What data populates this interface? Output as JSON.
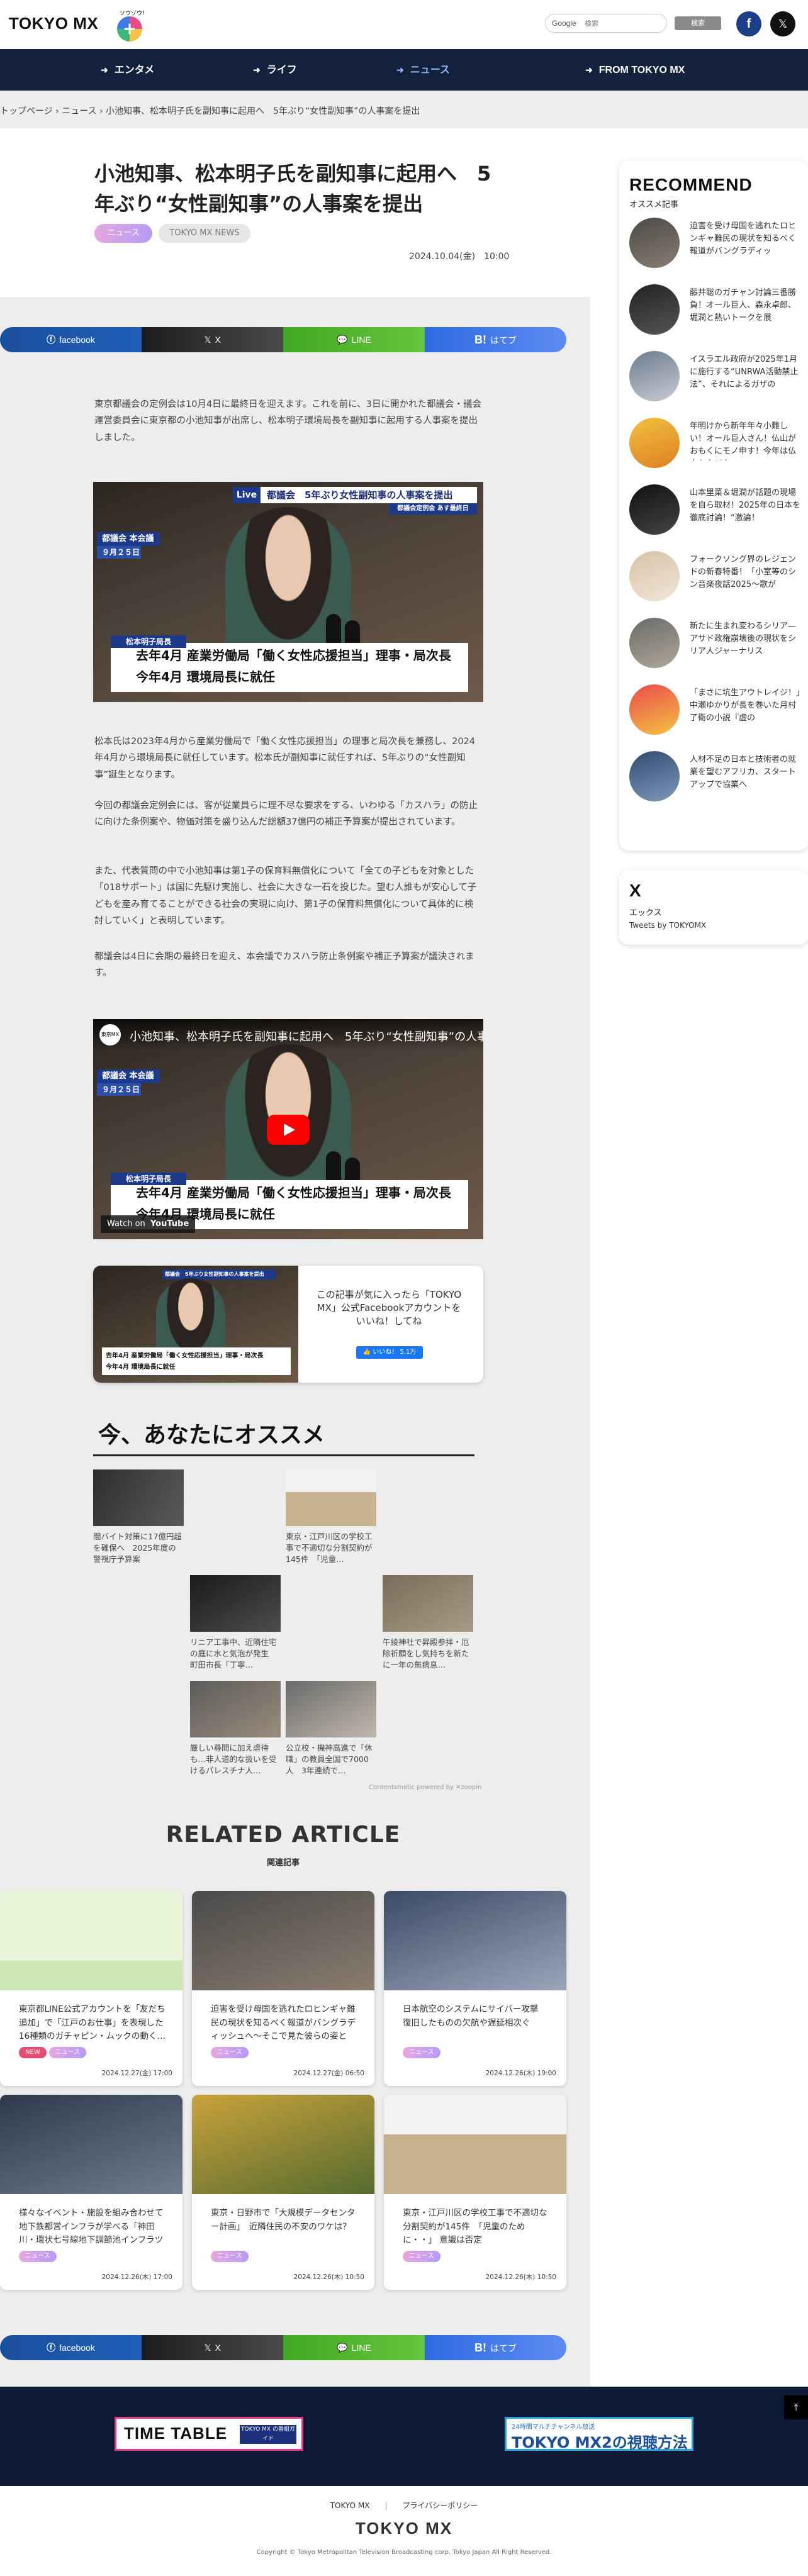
{
  "header": {
    "logo_text": "TOKYO MX",
    "logo_sub": "ソウゾウ！",
    "search_label": "Google",
    "search_placeholder": "検索",
    "search_button": "検索",
    "facebook_icon": "f",
    "x_icon": "𝕏"
  },
  "nav": {
    "items": [
      {
        "label": "エンタメ"
      },
      {
        "label": "ライフ"
      },
      {
        "label": "ニュース"
      },
      {
        "label": "FROM TOKYO MX"
      }
    ],
    "active_index": 2
  },
  "breadcrumb": "トップページ  ›  ニュース  ›  小池知事、松本明子氏を副知事に起用へ　5年ぶり“女性副知事”の人事案を提出",
  "article": {
    "title": "小池知事、松本明子氏を副知事に起用へ　5年ぶり“女性副知事”の人事案を提出",
    "tags": [
      "ニュース",
      "TOKYO MX NEWS"
    ],
    "date": "2024.10.04(金)　10:00",
    "share": {
      "facebook": "facebook",
      "x": "X",
      "line": "LINE",
      "hatena": "はてブ",
      "hatena_mark": "B!"
    },
    "paragraphs": [
      "東京都議会の定例会は10月4日に最終日を迎えます。これを前に、3日に開かれた都議会・議会運営委員会に東京都の小池知事が出席し、松本明子環境局長を副知事に起用する人事案を提出しました。",
      "松本氏は2023年4月から産業労働局で「働く女性応援担当」の理事と局次長を兼務し、2024年4月から環境局長に就任しています。松本氏が副知事に就任すれば、5年ぶりの“女性副知事”誕生となります。",
      "今回の都議会定例会には、客が従業員らに理不尽な要求をする、いわゆる「カスハラ」の防止に向けた条例案や、物価対策を盛り込んだ総額37億円の補正予算案が提出されています。",
      "また、代表質問の中で小池知事は第1子の保育料無償化について「全ての子どもを対象とした「018サポート」は国に先駆け実施し、社会に大きな一石を投じた。望む人誰もが安心して子どもを産み育てることができる社会の実現に向け、第1子の保育料無償化について具体的に検討していく」と表明しています。",
      "都議会は4日に会期の最終日を迎え、本会議でカスハラ防止条例案や補正予算案が議決されます。"
    ],
    "photo": {
      "live": "Live",
      "banner": "都議会　5年ぶり女性副知事の人事案を提出",
      "banner_sub": "都議会定例会 あす最終日",
      "location": "都議会 本会議",
      "location_date": "９月２５日",
      "name": "松本明子局長",
      "line1": "去年4月 産業労働局「働く女性応援担当」理事・局次長",
      "line2": "今年4月 環境局長に就任"
    },
    "video": {
      "channel": "東京MX",
      "title": "小池知事、松本明子氏を副知事に起用へ　5年ぶり“女性副知事”の人事案を提出",
      "watch_on": "Watch on",
      "youtube": "YouTube"
    },
    "fb_promo": {
      "text": "この記事が気に入ったら「TOKYO MX」公式Facebookアカウントをいいね！してね",
      "like": "👍 いいね！ 5.1万"
    }
  },
  "recommend": {
    "heading": "今、あなたにオススメ",
    "items": [
      {
        "caption": "闇バイト対策に17億円超を確保へ　2025年度の警視庁予算案"
      },
      {
        "caption": "東京・江戸川区の学校工事で不適切な分割契約が145件　「児童…"
      },
      {
        "caption": "リニア工事中、近隣住宅の庭に水と気泡が発生　町田市長「丁寧…"
      },
      {
        "caption": "午綾神社で昇殿参拝・厄除祈願をし気持ちを新たに一年の無病息…"
      },
      {
        "caption": "厳しい尋問に加え虐待も…非人道的な扱いを受けるパレスチナ人…"
      },
      {
        "caption": "公立校・機神高進で「休職」の教員全国で7000人　3年連続で…"
      }
    ],
    "powered": "Contentsmatic powered by ✕zoopin"
  },
  "related": {
    "heading": "RELATED ARTICLE",
    "sub": "関連記事",
    "cards": [
      {
        "title": "東京都LINE公式アカウントを「友だち追加」で「江戸のお仕事」を表現した16種類のガチャピン・ムックの動く…",
        "tags": [
          "NEW",
          "ニュース"
        ],
        "date": "2024.12.27(金) 17:00"
      },
      {
        "title": "迫害を受け母国を逃れたロヒンギャ難民の現状を知るべく報道がバングラディッシュへ～そこで見た彼らの姿と",
        "tags": [
          "ニュース"
        ],
        "date": "2024.12.27(金) 06:50"
      },
      {
        "title": "日本航空のシステムにサイバー攻撃　復旧したものの欠航や遅延相次ぐ",
        "tags": [
          "ニュース"
        ],
        "date": "2024.12.26(木) 19:00"
      },
      {
        "title": "様々なイベント・施設を組み合わせて地下鉄都営インフラが学べる「神田川・環状七号線地下調節池インフラツ",
        "tags": [
          "ニュース"
        ],
        "date": "2024.12.26(木) 17:00"
      },
      {
        "title": "東京・日野市で「大規模データセンター計画」　近隣住民の不安のワケは？",
        "tags": [
          "ニュース"
        ],
        "date": "2024.12.26(木) 10:50"
      },
      {
        "title": "東京・江戸川区の学校工事で不適切な分割契約が145件　「児童のために・・」 意識は否定",
        "tags": [
          "ニュース"
        ],
        "date": "2024.12.26(木) 10:50"
      }
    ]
  },
  "sidebar": {
    "title": "RECOMMEND",
    "sub": "オススメ記事",
    "items": [
      {
        "text": "迫害を受け母国を逃れたロヒンギャ難民の現状を知るべく報道がバングラディッ"
      },
      {
        "text": "藤井聡のガチャン討論三番勝負！オール巨人、森永卓郎、堀潤と熱いトークを展"
      },
      {
        "text": "イスラエル政府が2025年1月に施行する“UNRWA活動禁止法”、それによるガザの"
      },
      {
        "text": "年明けから新年年々小難しい！オール巨人さん！仏山がおもくにモノ申す！今年は仏山もタジタ"
      },
      {
        "text": "山本里菜＆堀潤が話題の現場を自ら取材！2025年の日本を徹底討論！“激論！"
      },
      {
        "text": "フォークソング界のレジェンドの新春特番！「小室等のシン音楽夜話2025～歌が"
      },
      {
        "text": "新たに生まれ変わるシリア—アサド政権崩壊後の現状をシリア人ジャーナリス"
      },
      {
        "text": "「まさに坑生アウトレイジ！」中瀬ゆかりが長を巻いた月村了衛の小説『虚の"
      },
      {
        "text": "人材不足の日本と技術者の就業を望むアフリカ、スタートアップで協業へ"
      }
    ]
  },
  "xwidget": {
    "title": "X",
    "sub": "エックス",
    "link": "Tweets by TOKYOMX"
  },
  "footer": {
    "top_btn": "⤒",
    "timetable": "TIME TABLE",
    "timetable_sub": "TOKYO MX の番組ガイド",
    "mx2_sub": "24時間マルチチャンネル放送",
    "mx2_title": "TOKYO MX2の視聴方法",
    "links": [
      "TOKYO MX",
      "プライバシーポリシー"
    ],
    "logo": "TOKYO MX",
    "copyright": "Copyright © Tokyo Metropolitan Television Broadcasting corp. Tokyo Japan All Right Reserved."
  }
}
